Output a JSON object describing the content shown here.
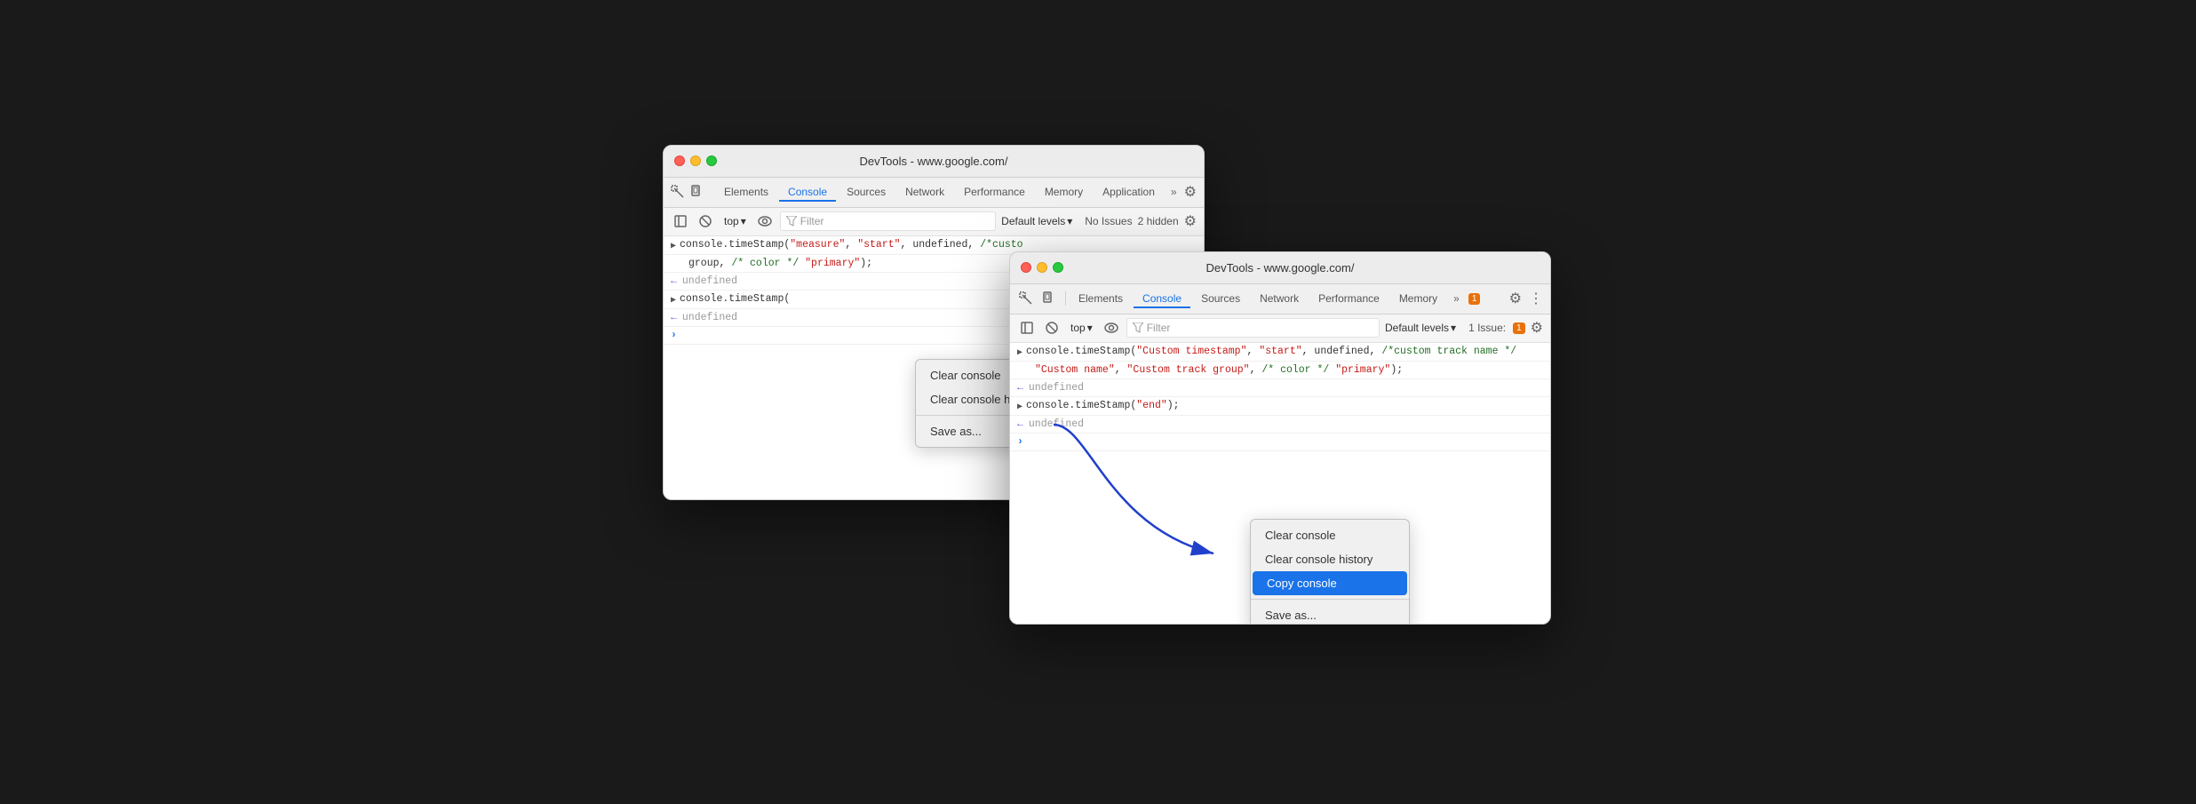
{
  "back_window": {
    "title": "DevTools - www.google.com/",
    "tabs": [
      "Elements",
      "Console",
      "Sources",
      "Network",
      "Performance",
      "Memory",
      "Application"
    ],
    "active_tab": "Console",
    "console_toolbar": {
      "top_label": "top",
      "filter_placeholder": "Filter",
      "default_levels": "Default levels",
      "no_issues": "No Issues",
      "hidden_count": "2 hidden"
    },
    "console_lines": [
      {
        "type": "input",
        "text": "console.timeStamp(\"measure\", \"start\", undefined, /*custo",
        "continuation": "group\", /* color */ \"primary\");"
      },
      {
        "type": "result",
        "text": "undefined"
      },
      {
        "type": "input",
        "text": "console.timeStamp("
      },
      {
        "type": "result",
        "text": "undefined"
      },
      {
        "type": "caret"
      }
    ],
    "context_menu": {
      "items": [
        "Clear console",
        "Clear console history",
        "Save as..."
      ]
    }
  },
  "front_window": {
    "title": "DevTools - www.google.com/",
    "tabs": [
      "Elements",
      "Console",
      "Sources",
      "Network",
      "Performance",
      "Memory"
    ],
    "active_tab": "Console",
    "badge_count": "1",
    "console_toolbar": {
      "top_label": "top",
      "filter_placeholder": "Filter",
      "default_levels": "Default levels",
      "issues_label": "1 Issue:",
      "issues_badge": "1"
    },
    "console_lines": [
      {
        "type": "input",
        "parts": [
          {
            "text": "console.timeStamp(",
            "class": ""
          },
          {
            "text": "\"Custom timestamp\"",
            "class": "str"
          },
          {
            "text": ", ",
            "class": ""
          },
          {
            "text": "\"start\"",
            "class": "str"
          },
          {
            "text": ", undefined, ",
            "class": ""
          },
          {
            "text": "/*custom track name */",
            "class": "comment"
          },
          {
            "text": "",
            "class": ""
          },
          {
            "text": "\"Custom name\"",
            "class": "str"
          },
          {
            "text": ", ",
            "class": ""
          },
          {
            "text": "\"Custom track group\"",
            "class": "str"
          },
          {
            "text": ", ",
            "class": ""
          },
          {
            "text": "/* color */",
            "class": "comment"
          },
          {
            "text": " ",
            "class": ""
          },
          {
            "text": "\"primary\"",
            "class": "str"
          },
          {
            "text": ");",
            "class": ""
          }
        ]
      },
      {
        "type": "result",
        "text": "undefined"
      },
      {
        "type": "input_short",
        "text": "console.timeStamp(\"end\");"
      },
      {
        "type": "result",
        "text": "undefined"
      },
      {
        "type": "caret"
      }
    ],
    "context_menu": {
      "items": [
        "Clear console",
        "Clear console history",
        "Copy console",
        "Save as..."
      ],
      "highlighted_index": 2
    }
  },
  "icons": {
    "inspect": "⬚",
    "cursor": "↖",
    "eye": "👁",
    "filter": "⊘",
    "gear": "⚙",
    "more": "⋮",
    "overflow": "»",
    "chevron_down": "▾",
    "expand": "›",
    "sidebar": "▣",
    "ban": "⊘"
  }
}
